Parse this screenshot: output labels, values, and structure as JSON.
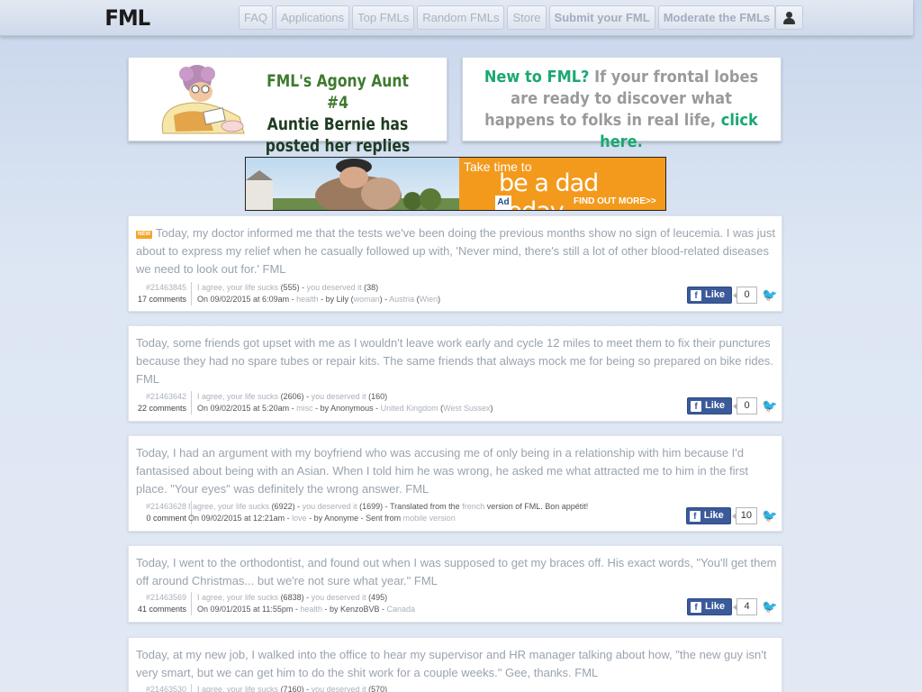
{
  "header": {
    "logo": "FML",
    "nav": [
      {
        "label": "FAQ",
        "bold": false
      },
      {
        "label": "Applications",
        "bold": false
      },
      {
        "label": "Top FMLs",
        "bold": false
      },
      {
        "label": "Random FMLs",
        "bold": false
      },
      {
        "label": "Store",
        "bold": false
      },
      {
        "label": "Submit your FML",
        "bold": true
      },
      {
        "label": "Moderate the FMLs",
        "bold": true
      }
    ],
    "user_icon": "user-icon"
  },
  "banners": {
    "agony": {
      "line1": "FML's Agony Aunt #4",
      "line2": "Auntie Bernie has",
      "line3": "posted her replies"
    },
    "newto": {
      "green1": "New to FML?",
      "text": " If your frontal lobes are ready to discover what happens to folks in real life, ",
      "green2": "click here."
    }
  },
  "ad": {
    "line1": "Take time to",
    "line2": "be a dad today.",
    "line3": "FIND OUT MORE>>",
    "badge": "Ad"
  },
  "posts": [
    {
      "is_new": true,
      "new_label": "NEW",
      "text": "Today, my doctor informed me that the tests we've been doing the previous months show no sign of leucemia. I was just about to express my relief when he casually followed up with, 'Never mind, there's still a lot of other blood-related diseases we need to look out for.' FML",
      "id": "#21463845",
      "comments": "17 comments",
      "agree_label": "I agree, your life sucks",
      "agree_count": "(555)",
      "deserved_label": "you deserved it",
      "deserved_count": "(38)",
      "date": "On 09/02/2015 at 6:09am",
      "category": "health",
      "by": "by Lily",
      "gender": "woman",
      "country": "Austria",
      "region": "Wien",
      "extra": "",
      "like_label": "Like",
      "likes": "0"
    },
    {
      "is_new": false,
      "text": "Today, some friends got upset with me as I wouldn't leave work early and cycle 12 miles to meet them to fix their punctures because they had no spare tubes or repair kits. The same friends that always mock me for being so prepared on bike rides. FML",
      "id": "#21463642",
      "comments": "22 comments",
      "agree_label": "I agree, your life sucks",
      "agree_count": "(2606)",
      "deserved_label": "you deserved it",
      "deserved_count": "(160)",
      "date": "On 09/02/2015 at 5:20am",
      "category": "misc",
      "by": "by Anonymous",
      "gender": "",
      "country": "United Kingdom",
      "region": "West Sussex",
      "extra": "",
      "like_label": "Like",
      "likes": "0"
    },
    {
      "is_new": false,
      "text": "Today, I had an argument with my boyfriend who was accusing me of only being in a relationship with him because I'd fantasised about being with an Asian. When I told him he was wrong, he asked me what attracted me to him in the first place. \"Your eyes\" was definitely the wrong answer. FML",
      "id": "#21463628",
      "comments": "0 comment",
      "agree_label": "I agree, your life sucks",
      "agree_count": "(6922)",
      "deserved_label": "you deserved it",
      "deserved_count": "(1699)",
      "translated_prefix": " - Translated from the ",
      "translated_lang": "french",
      "translated_suffix": " version of FML. Bon appétit!",
      "date": "On 09/02/2015 at 12:21am",
      "category": "love",
      "by": "by Anonyme",
      "sent_from": "Sent from",
      "sent_via": "mobile version",
      "like_label": "Like",
      "likes": "10"
    },
    {
      "is_new": false,
      "text": "Today, I went to the orthodontist, and found out when I was supposed to get my braces off. His exact words, \"You'll get them off around Christmas... but we're not sure what year.\" FML",
      "id": "#21463569",
      "comments": "41 comments",
      "agree_label": "I agree, your life sucks",
      "agree_count": "(6838)",
      "deserved_label": "you deserved it",
      "deserved_count": "(495)",
      "date": "On 09/01/2015 at 11:55pm",
      "category": "health",
      "by": "by KenzoBVB",
      "country": "Canada",
      "like_label": "Like",
      "likes": "4"
    },
    {
      "is_new": false,
      "text": "Today, at my new job, I walked into the office to hear my supervisor and HR manager talking about how, \"the new guy isn't very smart, but we can get him to do the shit work for a couple weeks.\" Gee, thanks. FML",
      "id": "#21463530",
      "agree_label": "I agree, your life sucks",
      "agree_count": "(7160)",
      "deserved_label": "you deserved it",
      "deserved_count": "(570)"
    }
  ]
}
